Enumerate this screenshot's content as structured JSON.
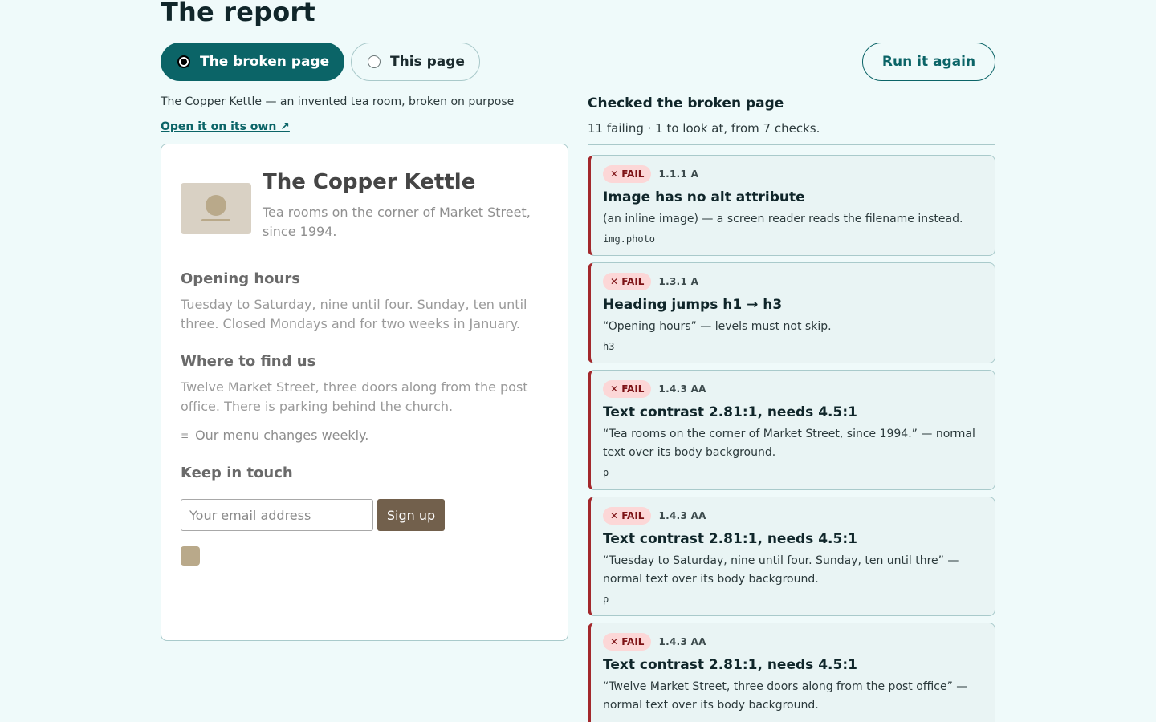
{
  "header": {
    "title": "The report",
    "rerun_label": "Run it again"
  },
  "mode": {
    "options": [
      {
        "label": "The broken page",
        "selected": true
      },
      {
        "label": "This page",
        "selected": false
      }
    ]
  },
  "source": {
    "caption": "The Copper Kettle — an invented tea room, broken on purpose",
    "open_link": "Open it on its own ↗"
  },
  "preview": {
    "title": "The Copper Kettle",
    "tagline": "Tea rooms on the corner of Market Street, since 1994.",
    "sections": [
      {
        "heading": "Opening hours",
        "text": "Tuesday to Saturday, nine until four. Sunday, ten until three. Closed Mondays and for two weeks in January."
      },
      {
        "heading": "Where to find us",
        "text": "Twelve Market Street, three doors along from the post office. There is parking behind the church."
      }
    ],
    "menu_note": {
      "icon": "≡",
      "text": "Our menu changes weekly."
    },
    "signup": {
      "heading": "Keep in touch",
      "placeholder": "Your email address",
      "button": "Sign up"
    }
  },
  "results": {
    "title": "Checked the broken page",
    "summary": "11 failing · 1 to look at, from 7 checks.",
    "issues": [
      {
        "badge": "✕ FAIL",
        "criterion": "1.1.1 A",
        "title": "Image has no alt attribute",
        "description": "(an inline image) — a screen reader reads the filename instead.",
        "selector": "img.photo"
      },
      {
        "badge": "✕ FAIL",
        "criterion": "1.3.1 A",
        "title": "Heading jumps h1 → h3",
        "description": "“Opening hours” — levels must not skip.",
        "selector": "h3"
      },
      {
        "badge": "✕ FAIL",
        "criterion": "1.4.3 AA",
        "title": "Text contrast 2.81:1, needs 4.5:1",
        "description": "“Tea rooms on the corner of Market Street, since 1994.” — normal text over its body background.",
        "selector": "p"
      },
      {
        "badge": "✕ FAIL",
        "criterion": "1.4.3 AA",
        "title": "Text contrast 2.81:1, needs 4.5:1",
        "description": "“Tuesday to Saturday, nine until four. Sunday, ten until thre” — normal text over its body background.",
        "selector": "p"
      },
      {
        "badge": "✕ FAIL",
        "criterion": "1.4.3 AA",
        "title": "Text contrast 2.81:1, needs 4.5:1",
        "description": "“Twelve Market Street, three doors along from the post office” — normal text over its body background.",
        "selector": ""
      }
    ]
  },
  "colors": {
    "accent": "#0b6467",
    "fail": "#a3282c",
    "background": "#effafa"
  }
}
